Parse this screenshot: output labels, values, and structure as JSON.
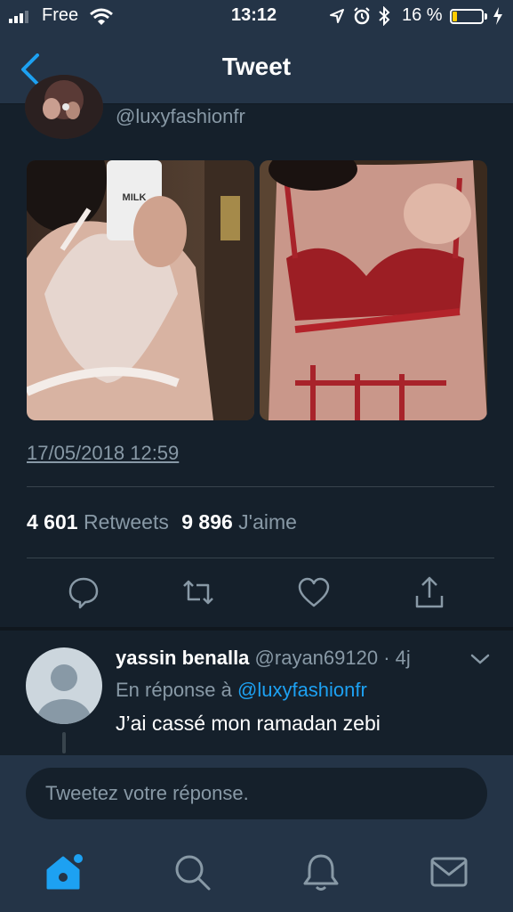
{
  "status_bar": {
    "carrier": "Free",
    "time": "13:12",
    "battery_percent": "16 %",
    "battery_level": 0.16
  },
  "nav": {
    "title": "Tweet"
  },
  "tweet": {
    "handle": "@luxyfashionfr",
    "timestamp": "17/05/2018 12:59",
    "retweets_count": "4 601",
    "retweets_label": "Retweets",
    "likes_count": "9 896",
    "likes_label": "J'aime",
    "images": [
      {
        "caption": "MILK",
        "tone": "white-lace"
      },
      {
        "tone": "red-lace"
      }
    ],
    "actions": [
      "reply-icon",
      "retweet-icon",
      "like-icon",
      "share-icon"
    ]
  },
  "reply": {
    "name": "yassin benalla",
    "handle": "@rayan69120",
    "age": "· 4j",
    "in_reply_prefix": "En réponse à",
    "in_reply_handle": "@luxyfashionfr",
    "text": "J’ai cassé mon ramadan zebi"
  },
  "composer": {
    "placeholder": "Tweetez votre réponse."
  },
  "tab_bar": [
    "home-icon",
    "search-icon",
    "notifications-icon",
    "messages-icon"
  ],
  "colors": {
    "background": "#15202b",
    "bars": "#243447",
    "accent": "#1da1f2",
    "muted": "#8899a6",
    "battery": "#ffcc00"
  }
}
